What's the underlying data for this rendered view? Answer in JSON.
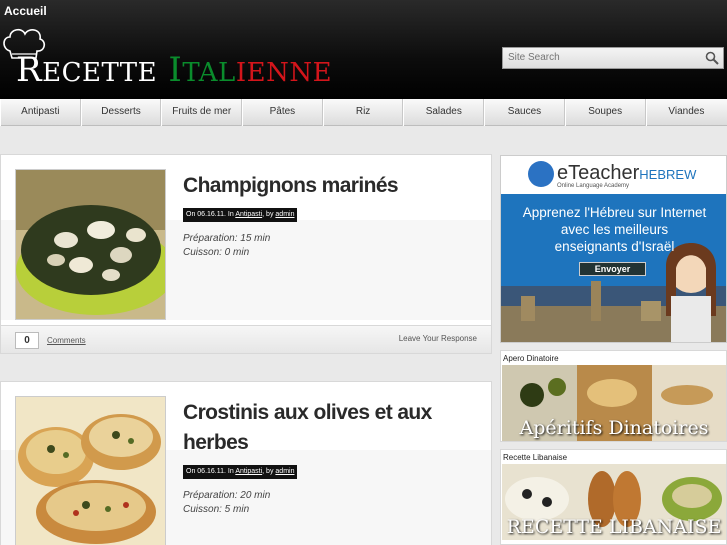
{
  "header": {
    "home_link": "Accueil",
    "logo": {
      "word1_initial": "R",
      "word1_rest": "ECETTE",
      "word2_initial": "I",
      "word2_mid": "TAL",
      "word2_rest": "IENNE"
    },
    "search_placeholder": "Site Search"
  },
  "nav": {
    "items": [
      {
        "label": "Antipasti"
      },
      {
        "label": "Desserts"
      },
      {
        "label": "Fruits de mer"
      },
      {
        "label": "Pâtes"
      },
      {
        "label": "Riz"
      },
      {
        "label": "Salades"
      },
      {
        "label": "Sauces"
      },
      {
        "label": "Soupes"
      },
      {
        "label": "Viandes"
      }
    ]
  },
  "posts": [
    {
      "title": "Champignons marinés",
      "meta_prefix": "On 06.16.11. In ",
      "category": "Antipasti",
      "meta_by": ", by ",
      "author": "admin",
      "preparation": "Préparation: 15 min",
      "cuisson": "Cuisson: 0 min",
      "comment_count": "0",
      "comments_label": "Comments",
      "leave_response": "Leave Your Response"
    },
    {
      "title": "Crostinis aux olives et aux herbes",
      "meta_prefix": "On 06.16.11. In ",
      "category": "Antipasti",
      "meta_by": ", by ",
      "author": "admin",
      "preparation": "Préparation: 20 min",
      "cuisson": "Cuisson: 5 min"
    }
  ],
  "sidebar": {
    "ad": {
      "brand": "eTeacher",
      "brand_suffix": "HEBREW",
      "tagline": "Online Language Academy",
      "headline_1": "Apprenez l'Hébreu sur Internet",
      "headline_2": "avec les meilleurs",
      "headline_3": "enseignants d'Israël",
      "button": "Envoyer"
    },
    "widgets": [
      {
        "title": "Apero Dinatoire",
        "caption": "Apéritifs Dinatoires"
      },
      {
        "title": "Recette Libanaise",
        "caption": "RECETTE LIBANAISE"
      }
    ]
  },
  "colors": {
    "header_bg": "#000000",
    "logo_green": "#0a8c2c",
    "logo_red": "#d3151b",
    "ad_blue": "#1b6fb8"
  }
}
